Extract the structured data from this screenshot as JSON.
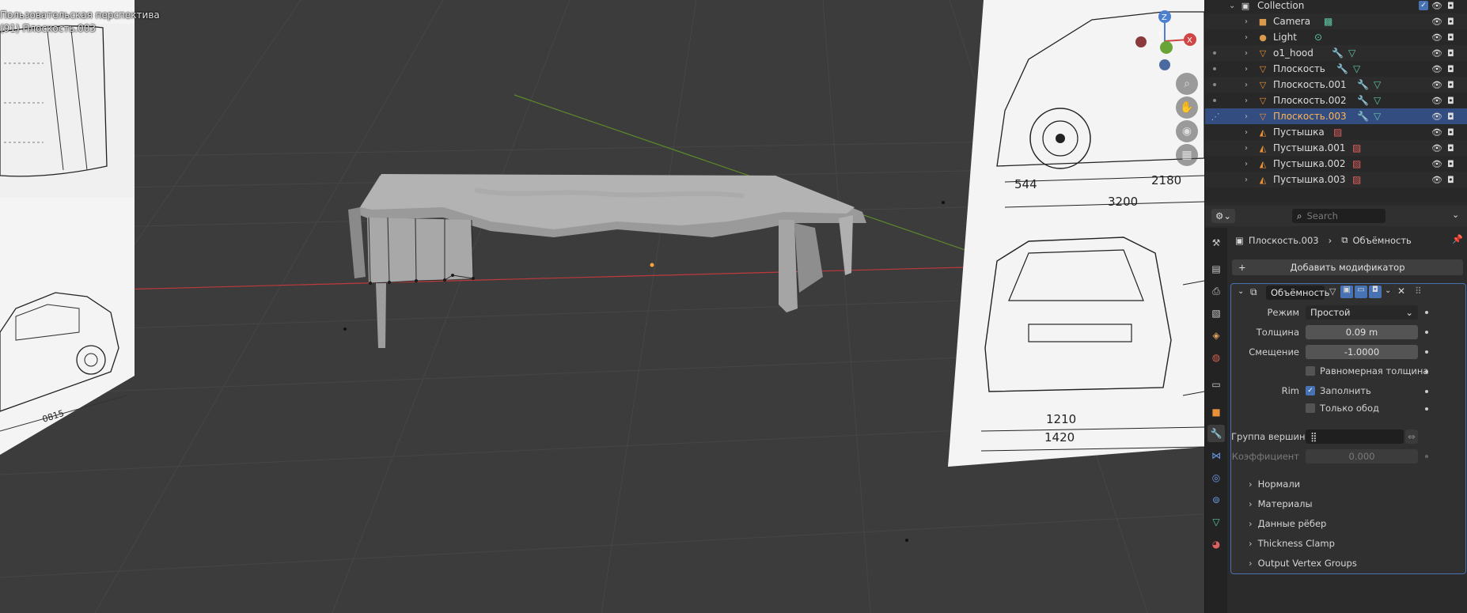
{
  "viewport": {
    "title": "Пользовательская перспектива",
    "object_label": "(91) Плоскость.003",
    "gizmo": {
      "z": "Z",
      "y": "Y",
      "x": "X"
    },
    "blueprint_dims": [
      "544",
      "2180",
      "3200",
      "1210",
      "1420",
      "0815"
    ]
  },
  "outliner": {
    "rows": [
      {
        "name": "Collection",
        "type": "collection"
      },
      {
        "name": "Camera",
        "type": "camera"
      },
      {
        "name": "Light",
        "type": "light"
      },
      {
        "name": "o1_hood",
        "type": "mesh"
      },
      {
        "name": "Плоскость",
        "type": "mesh"
      },
      {
        "name": "Плоскость.001",
        "type": "mesh"
      },
      {
        "name": "Плоскость.002",
        "type": "mesh"
      },
      {
        "name": "Плоскость.003",
        "type": "mesh",
        "selected": true
      },
      {
        "name": "Пустышка",
        "type": "empty"
      },
      {
        "name": "Пустышка.001",
        "type": "empty"
      },
      {
        "name": "Пустышка.002",
        "type": "empty"
      },
      {
        "name": "Пустышка.003",
        "type": "empty"
      }
    ]
  },
  "properties": {
    "search_placeholder": "Search",
    "breadcrumb": {
      "object": "Плоскость.003",
      "modifier": "Объёмность"
    },
    "add_modifier": "Добавить модификатор",
    "modifier": {
      "name": "Объёмность",
      "mode_label": "Режим",
      "mode_value": "Простой",
      "thickness_label": "Толщина",
      "thickness_value": "0.09 m",
      "offset_label": "Смещение",
      "offset_value": "-1.0000",
      "even_thickness": "Равномерная толщина",
      "rim_label": "Rim",
      "fill_label": "Заполнить",
      "fill_checked": true,
      "only_rim": "Только обод",
      "vgroup_label": "Группа вершин",
      "factor_label": "Коэффициент",
      "factor_value": "0.000",
      "panels": [
        "Нормали",
        "Материалы",
        "Данные рёбер",
        "Thickness Clamp",
        "Output Vertex Groups"
      ]
    }
  },
  "colors": {
    "accent": "#4772b3",
    "selected_row": "#334d80",
    "selected_text": "#ffb454",
    "x_axis": "#c0393b",
    "y_axis": "#5b8a2a"
  }
}
